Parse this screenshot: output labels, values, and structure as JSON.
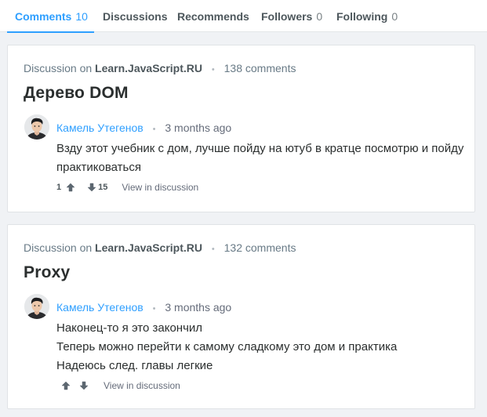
{
  "tabs": [
    {
      "label": "Comments",
      "count": "10"
    },
    {
      "label": "Discussions",
      "count": ""
    },
    {
      "label": "Recommends",
      "count": ""
    },
    {
      "label": "Followers",
      "count": "0"
    },
    {
      "label": "Following",
      "count": "0"
    }
  ],
  "accent_color": "#2e9fff",
  "comments": [
    {
      "discussion_prefix": "Discussion on",
      "site": "Learn.JavaScript.RU",
      "comments_count": "138 comments",
      "thread_title": "Дерево DOM",
      "author": "Камель Утегенов",
      "time": "3 months ago",
      "lines": [
        "Взду этот учебник с дом, лучше пойду на ютуб в кратце посмотрю и пойду практиковаться"
      ],
      "upvotes": "1",
      "downvotes": "15",
      "view_link": "View in discussion"
    },
    {
      "discussion_prefix": "Discussion on",
      "site": "Learn.JavaScript.RU",
      "comments_count": "132 comments",
      "thread_title": "Proxy",
      "author": "Камель Утегенов",
      "time": "3 months ago",
      "lines": [
        "Наконец-то я это закончил",
        "Теперь можно перейти к самому сладкому это дом и практика",
        "Надеюсь след. главы легкие"
      ],
      "upvotes": "",
      "downvotes": "",
      "view_link": "View in discussion"
    }
  ]
}
